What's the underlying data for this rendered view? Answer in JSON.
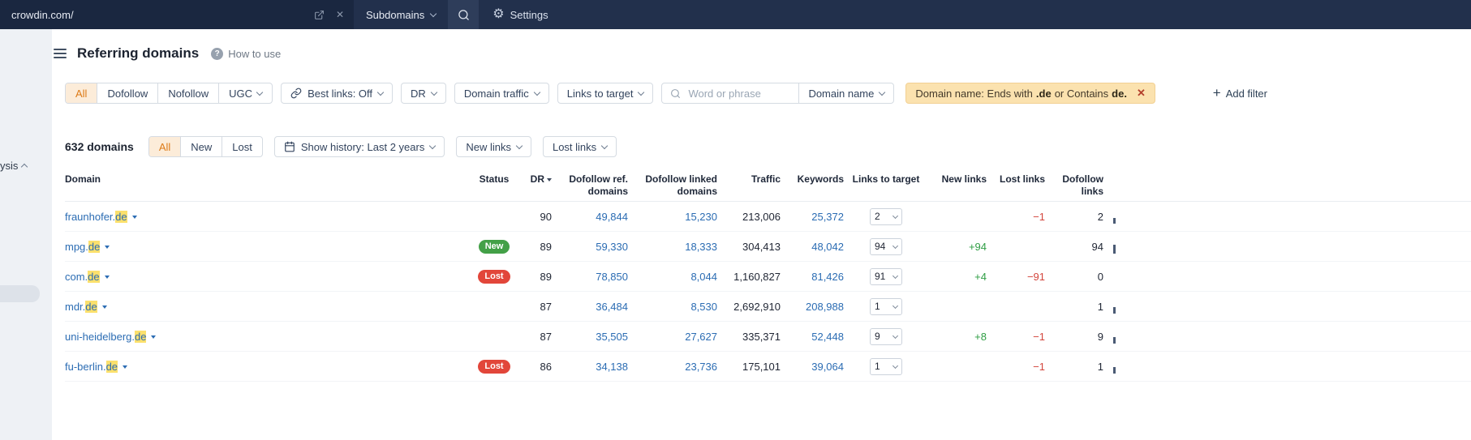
{
  "topbar": {
    "url": "crowdin.com/",
    "mode": "Subdomains",
    "settings": "Settings"
  },
  "sidebar": {
    "partial_item": "ysis"
  },
  "header": {
    "title": "Referring domains",
    "help": "How to use"
  },
  "icons": {
    "close": "✕",
    "gear": "⚙",
    "plus": "+",
    "help": "?"
  },
  "filter_bar": {
    "segments": [
      "All",
      "Dofollow",
      "Nofollow",
      "UGC"
    ],
    "best_links": "Best links: Off",
    "dr": "DR",
    "domain_traffic": "Domain traffic",
    "links_to_target": "Links to target",
    "search_placeholder": "Word or phrase",
    "search_scope": "Domain name",
    "active_filter": {
      "part1": "Domain name: Ends with",
      "bold1": ".de",
      "part2": "or Contains",
      "bold2": "de."
    },
    "add_filter": "Add filter"
  },
  "toolbar": {
    "count": "632 domains",
    "segments": [
      "All",
      "New",
      "Lost"
    ],
    "show_history": "Show history: Last 2 years",
    "new_links": "New links",
    "lost_links": "Lost links"
  },
  "table": {
    "headers": {
      "domain": "Domain",
      "status": "Status",
      "dr": "DR",
      "dofollow_ref": "Dofollow ref. domains",
      "dofollow_linked": "Dofollow linked domains",
      "traffic": "Traffic",
      "keywords": "Keywords",
      "links_to_target": "Links to target",
      "new_links": "New links",
      "lost_links": "Lost links",
      "dofollow_links": "Dofollow links"
    },
    "rows": [
      {
        "domain_prefix": "fraunhofer.",
        "domain_highlight": "de",
        "status": "",
        "dr": "90",
        "dofollow_ref": "49,844",
        "dofollow_linked": "15,230",
        "traffic": "213,006",
        "keywords": "25,372",
        "links_to_target": "2",
        "new_links": "",
        "lost_links": "−1",
        "dofollow_links": "2",
        "spark": 7
      },
      {
        "domain_prefix": "mpg.",
        "domain_highlight": "de",
        "status": "New",
        "dr": "89",
        "dofollow_ref": "59,330",
        "dofollow_linked": "18,333",
        "traffic": "304,413",
        "keywords": "48,042",
        "links_to_target": "94",
        "new_links": "+94",
        "lost_links": "",
        "dofollow_links": "94",
        "spark": 11
      },
      {
        "domain_prefix": "com.",
        "domain_highlight": "de",
        "status": "Lost",
        "dr": "89",
        "dofollow_ref": "78,850",
        "dofollow_linked": "8,044",
        "traffic": "1,160,827",
        "keywords": "81,426",
        "links_to_target": "91",
        "new_links": "+4",
        "lost_links": "−91",
        "dofollow_links": "0",
        "spark": 0
      },
      {
        "domain_prefix": "mdr.",
        "domain_highlight": "de",
        "status": "",
        "dr": "87",
        "dofollow_ref": "36,484",
        "dofollow_linked": "8,530",
        "traffic": "2,692,910",
        "keywords": "208,988",
        "links_to_target": "1",
        "new_links": "",
        "lost_links": "",
        "dofollow_links": "1",
        "spark": 8
      },
      {
        "domain_prefix": "uni-heidelberg.",
        "domain_highlight": "de",
        "status": "",
        "dr": "87",
        "dofollow_ref": "35,505",
        "dofollow_linked": "27,627",
        "traffic": "335,371",
        "keywords": "52,448",
        "links_to_target": "9",
        "new_links": "+8",
        "lost_links": "−1",
        "dofollow_links": "9",
        "spark": 8
      },
      {
        "domain_prefix": "fu-berlin.",
        "domain_highlight": "de",
        "status": "Lost",
        "dr": "86",
        "dofollow_ref": "34,138",
        "dofollow_linked": "23,736",
        "traffic": "175,101",
        "keywords": "39,064",
        "links_to_target": "1",
        "new_links": "",
        "lost_links": "−1",
        "dofollow_links": "1",
        "spark": 8
      }
    ]
  }
}
